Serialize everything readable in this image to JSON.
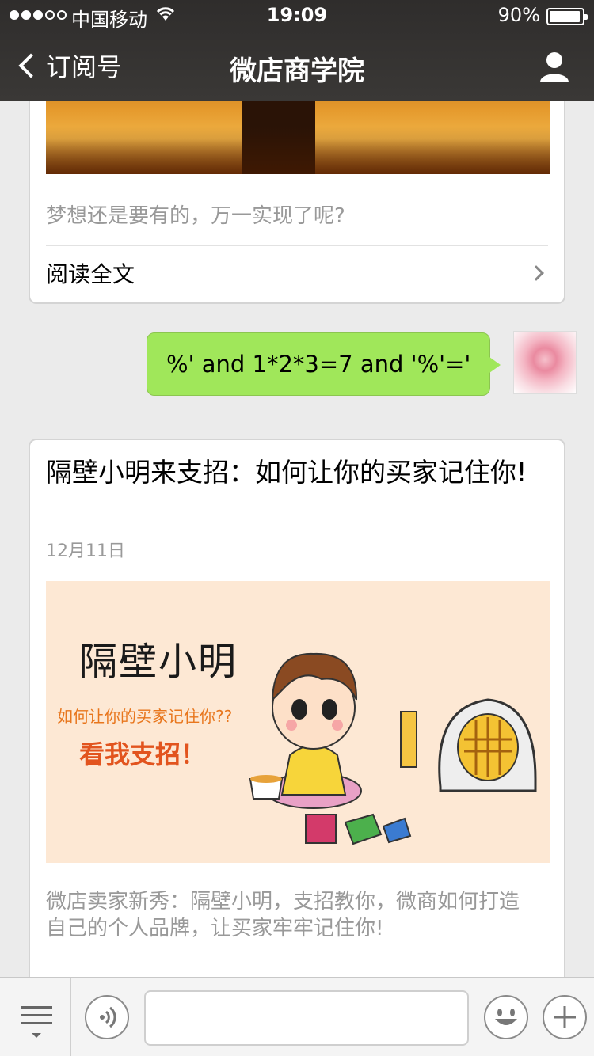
{
  "status_bar": {
    "carrier": "中国移动",
    "time": "19:09",
    "battery_percent": "90%",
    "battery_level": 0.9,
    "signal_bars_filled": 3,
    "signal_bars_total": 5
  },
  "nav": {
    "back_label": "订阅号",
    "title": "微店商学院",
    "profile_icon": "person-icon"
  },
  "messages": {
    "article1": {
      "description": "梦想还是要有的，万一实现了呢?",
      "read_more": "阅读全文"
    },
    "user_bubble": {
      "text": "%' and 1*2*3=7 and '%'='"
    },
    "article2": {
      "title": "隔壁小明来支招：如何让你的买家记住你!",
      "date": "12月11日",
      "cover": {
        "title": "隔壁小明",
        "subtitle": "如何让你的买家记住你??",
        "cta": "看我支招！"
      },
      "description": "微店卖家新秀：隔壁小明，支招教你，微商如何打造自己的个人品牌，让买家牢牢记住你!"
    }
  },
  "toolbar": {
    "menu_icon": "menu-list-icon",
    "voice_icon": "voice-icon",
    "emoji_icon": "emoji-icon",
    "plus_icon": "plus-icon"
  },
  "colors": {
    "nav_bg": "#2f2d2c",
    "bubble_green": "#a0e75a",
    "chat_bg": "#ebebeb",
    "cover_orange": "#e2541e"
  }
}
